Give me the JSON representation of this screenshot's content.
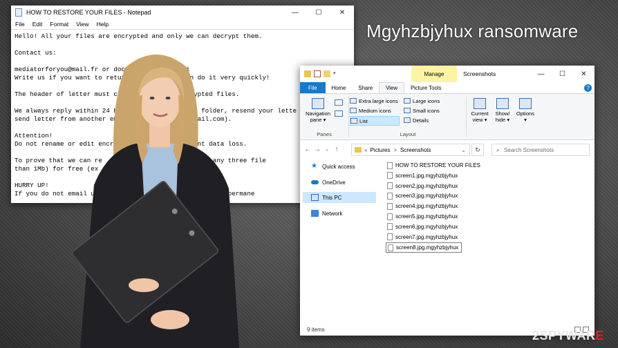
{
  "headline": "Mgyhzbjyhux ransomware",
  "notepad": {
    "title": "HOW TO RESTORE YOUR FILES - Notepad",
    "window_controls": [
      "—",
      "☐",
      "✕"
    ],
    "menu": [
      "File",
      "Edit",
      "Format",
      "View",
      "Help"
    ],
    "lines": [
      "Hello! All your files are encrypted and only we can decrypt them.",
      "",
      "Contact us:",
      "",
      "mediatorforyou@mail.fr or doctorhe          li",
      "Write us if you want to return y            can do it very quickly!",
      "",
      "The header of letter must conta             ncrypted files.",
      "",
      "We always reply within 24 hour              spam folder, resend your lette",
      "send letter from another emai               tonmail.com).",
      "",
      "Attention!",
      "Do not rename or edit encry                 manent data loss.",
      "",
      "To prove that we can re                     decrypt any three file",
      "than 1Mb) for free (ex",
      "",
      "HURRY UP!",
      "If you do not email u                       may be lost permane"
    ]
  },
  "explorer": {
    "manage_label": "Manage",
    "title": "Screenshots",
    "window_controls": [
      "—",
      "☐",
      "✕"
    ],
    "tabs": [
      "File",
      "Home",
      "Share",
      "View",
      "Picture Tools"
    ],
    "help": "?",
    "ribbon": {
      "navigation_pane": "Navigation pane ▾",
      "panes_label": "Panes",
      "layout_items": [
        "Extra large icons",
        "Large icons",
        "Medium icons",
        "Small icons",
        "List",
        "Details"
      ],
      "layout_label": "Layout",
      "current_view": "Current view ▾",
      "show_hide": "Show/ hide ▾",
      "options": "Options",
      "options_arrow": "▾"
    },
    "address": {
      "prefix": "«",
      "crumbs": [
        "Pictures",
        "Screenshots"
      ],
      "separator": ">",
      "dropdown": "⌄",
      "refresh": "↻",
      "search_placeholder": "Search Screenshots"
    },
    "nav_pane": [
      "Quick access",
      "OneDrive",
      "This PC",
      "Network"
    ],
    "files": [
      "HOW TO RESTORE YOUR FILES",
      "screen1.jpg.mgyhzbjyhux",
      "screen2.jpg.mgyhzbjyhux",
      "screen3.jpg.mgyhzbjyhux",
      "screen4.jpg.mgyhzbjyhux",
      "screen5.jpg.mgyhzbjyhux",
      "screen6.jpg.mgyhzbjyhux",
      "screen7.jpg.mgyhzbjyhux",
      "screen8.jpg.mgyhzbjyhux"
    ],
    "status": "9 items"
  },
  "watermark": {
    "prefix": "2SPYWAR",
    "suffix": "E"
  },
  "colors": {
    "file_tab": "#1979ca",
    "manage_bg": "#fcf3a3",
    "selection": "#cce8ff",
    "watermark_accent": "#e31b23"
  }
}
